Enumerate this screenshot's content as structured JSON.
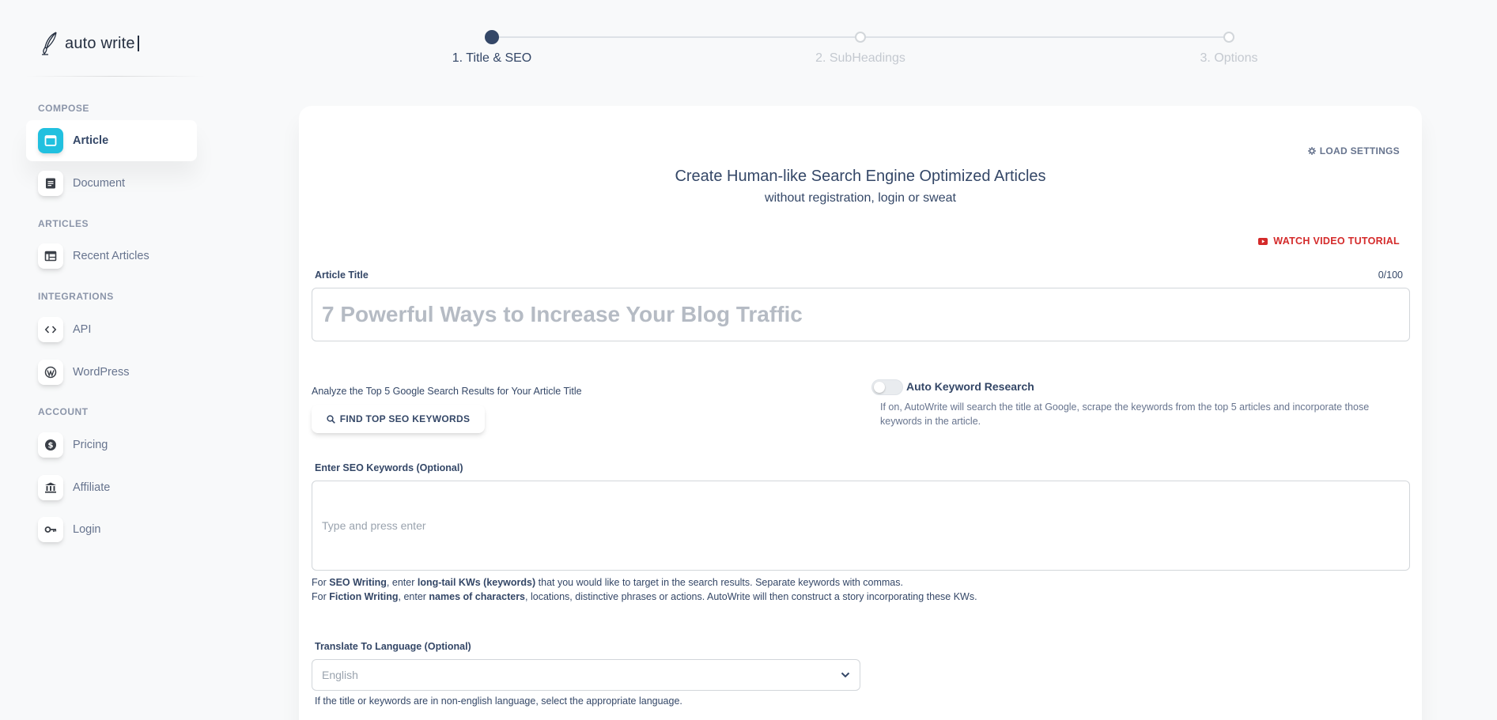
{
  "app": {
    "logo_text": "auto write"
  },
  "sidebar": {
    "sections": [
      {
        "label": "COMPOSE"
      },
      {
        "label": "ARTICLES"
      },
      {
        "label": "INTEGRATIONS"
      },
      {
        "label": "ACCOUNT"
      }
    ],
    "items": [
      {
        "label": "Article",
        "icon": "browser-window-icon",
        "active": true
      },
      {
        "label": "Document",
        "icon": "document-icon"
      },
      {
        "label": "Recent Articles",
        "icon": "table-layout-icon"
      },
      {
        "label": "API",
        "icon": "code-brackets-icon"
      },
      {
        "label": "WordPress",
        "icon": "wordpress-icon"
      },
      {
        "label": "Pricing",
        "icon": "dollar-coin-icon"
      },
      {
        "label": "Affiliate",
        "icon": "bank-icon"
      },
      {
        "label": "Login",
        "icon": "key-icon"
      }
    ]
  },
  "stepper": {
    "steps": [
      {
        "label": "1. Title & SEO",
        "active": true
      },
      {
        "label": "2. SubHeadings",
        "active": false
      },
      {
        "label": "3. Options",
        "active": false
      }
    ]
  },
  "main": {
    "load_settings": "LOAD SETTINGS",
    "headline": "Create Human-like Search Engine Optimized Articles",
    "subheadline": "without registration, login or sweat",
    "watch_video": "WATCH VIDEO TUTORIAL",
    "article_title": {
      "label": "Article Title",
      "counter": "0/100",
      "value": "",
      "placeholder": "7 Powerful Ways to Increase Your Blog Traffic"
    },
    "analyze_text": "Analyze the Top 5 Google Search Results for Your Article Title",
    "find_button": "FIND TOP SEO KEYWORDS",
    "auto_keyword": {
      "label": "Auto Keyword Research",
      "enabled": false,
      "help": "If on, AutoWrite will search the title at Google, scrape the keywords from the top 5 articles and incorporate those keywords in the article."
    },
    "seo_keywords": {
      "label": "Enter SEO Keywords (Optional)",
      "placeholder": "Type and press enter"
    },
    "help_seo": {
      "p1": "For ",
      "b1": "SEO Writing",
      "p2": ", enter ",
      "b2": "long-tail KWs (keywords)",
      "p3": " that you would like to target in the search results. Separate keywords with commas."
    },
    "help_fiction": {
      "p1": "For ",
      "b1": "Fiction Writing",
      "p2": ", enter ",
      "b2": "names of characters",
      "p3": ", locations, distinctive phrases or actions. AutoWrite will then construct a story incorporating these KWs."
    },
    "translate": {
      "label": "Translate To Language (Optional)",
      "selected": "English",
      "help": "If the title or keywords are in non-english language, select the appropriate language."
    }
  },
  "colors": {
    "accent": "#21c0df",
    "primary_text": "#344767",
    "secondary_text": "#67748e",
    "danger": "#d42a2a",
    "background": "#f8f9fa"
  }
}
